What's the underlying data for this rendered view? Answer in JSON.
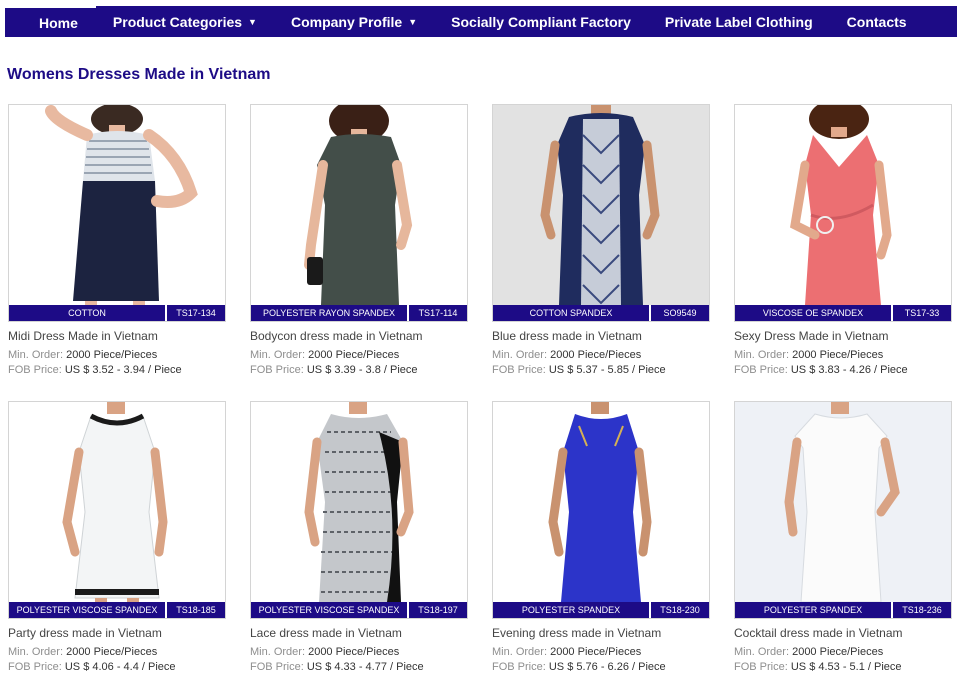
{
  "nav": [
    {
      "label": "Home",
      "dropdown": false
    },
    {
      "label": "Product Categories",
      "dropdown": true
    },
    {
      "label": "Company Profile",
      "dropdown": true
    },
    {
      "label": "Socially Compliant Factory",
      "dropdown": false
    },
    {
      "label": "Private Label Clothing",
      "dropdown": false
    },
    {
      "label": "Contacts",
      "dropdown": false
    }
  ],
  "caret": "▼",
  "page_title": "Womens Dresses Made in Vietnam",
  "labels": {
    "min_order": "Min. Order:",
    "fob_price": "FOB Price:"
  },
  "colors": {
    "brand": "#1d0b86"
  },
  "products": [
    {
      "name": "Midi Dress Made in Vietnam",
      "material": "COTTON",
      "code": "TS17-134",
      "min_order": "2000 Piece/Pieces",
      "price": "US $ 3.52 - 3.94 / Piece"
    },
    {
      "name": "Bodycon dress made in Vietnam",
      "material": "POLYESTER RAYON SPANDEX",
      "code": "TS17-114",
      "min_order": "2000 Piece/Pieces",
      "price": "US $ 3.39 - 3.8 / Piece"
    },
    {
      "name": "Blue dress made in Vietnam",
      "material": "COTTON SPANDEX",
      "code": "SO9549",
      "min_order": "2000 Piece/Pieces",
      "price": "US $ 5.37 - 5.85 / Piece"
    },
    {
      "name": "Sexy Dress Made in Vietnam",
      "material": "VISCOSE OE SPANDEX",
      "code": "TS17-33",
      "min_order": "2000 Piece/Pieces",
      "price": "US $ 3.83 - 4.26 / Piece"
    },
    {
      "name": "Party dress made in Vietnam",
      "material": "POLYESTER VISCOSE SPANDEX",
      "code": "TS18-185",
      "min_order": "2000 Piece/Pieces",
      "price": "US $ 4.06 - 4.4 / Piece"
    },
    {
      "name": "Lace dress made in Vietnam",
      "material": "POLYESTER VISCOSE SPANDEX",
      "code": "TS18-197",
      "min_order": "2000 Piece/Pieces",
      "price": "US $ 4.33 - 4.77 / Piece"
    },
    {
      "name": "Evening dress made in Vietnam",
      "material": "POLYESTER SPANDEX",
      "code": "TS18-230",
      "min_order": "2000 Piece/Pieces",
      "price": "US $ 5.76 - 6.26 / Piece"
    },
    {
      "name": "Cocktail dress made in Vietnam",
      "material": "POLYESTER SPANDEX",
      "code": "TS18-236",
      "min_order": "2000 Piece/Pieces",
      "price": "US $ 4.53 - 5.1 / Piece"
    }
  ]
}
